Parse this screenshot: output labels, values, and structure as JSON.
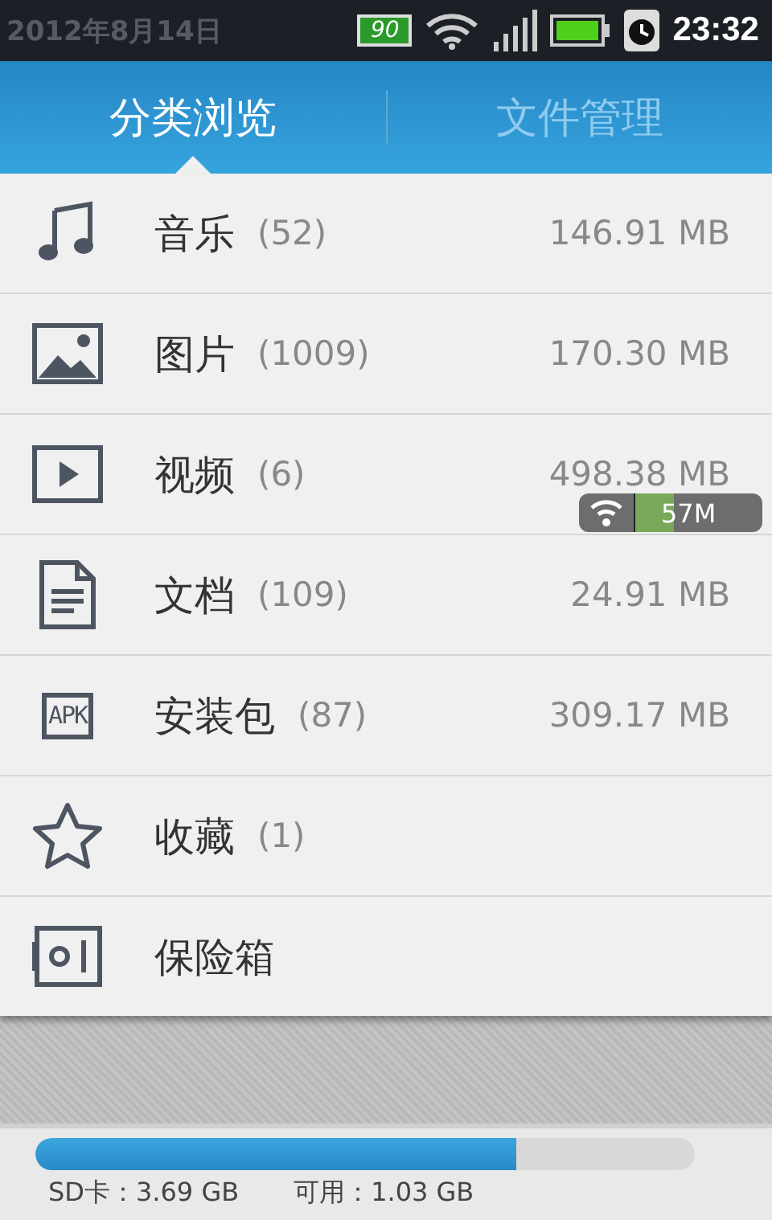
{
  "status_bar": {
    "date": "2012年8月14日",
    "battery_badge": "90",
    "time": "23:32"
  },
  "tabs": [
    {
      "label": "分类浏览",
      "selected": true
    },
    {
      "label": "文件管理",
      "selected": false
    }
  ],
  "categories": [
    {
      "kind": "music",
      "name": "音乐",
      "count": "(52)",
      "size": "146.91 MB"
    },
    {
      "kind": "image",
      "name": "图片",
      "count": "(1009)",
      "size": "170.30 MB"
    },
    {
      "kind": "video",
      "name": "视频",
      "count": "(6)",
      "size": "498.38 MB"
    },
    {
      "kind": "document",
      "name": "文档",
      "count": "(109)",
      "size": "24.91 MB"
    },
    {
      "kind": "apk",
      "name": "安装包",
      "count": "(87)",
      "size": "309.17 MB",
      "icon_label": "APK"
    },
    {
      "kind": "favorite",
      "name": "收藏",
      "count": "(1)"
    },
    {
      "kind": "safe",
      "name": "保险箱"
    }
  ],
  "traffic_widget": {
    "value": "57M",
    "level": 0.3
  },
  "storage": {
    "level": 0.73,
    "total": "SD卡：3.69 GB",
    "available": "可用：1.03 GB"
  }
}
